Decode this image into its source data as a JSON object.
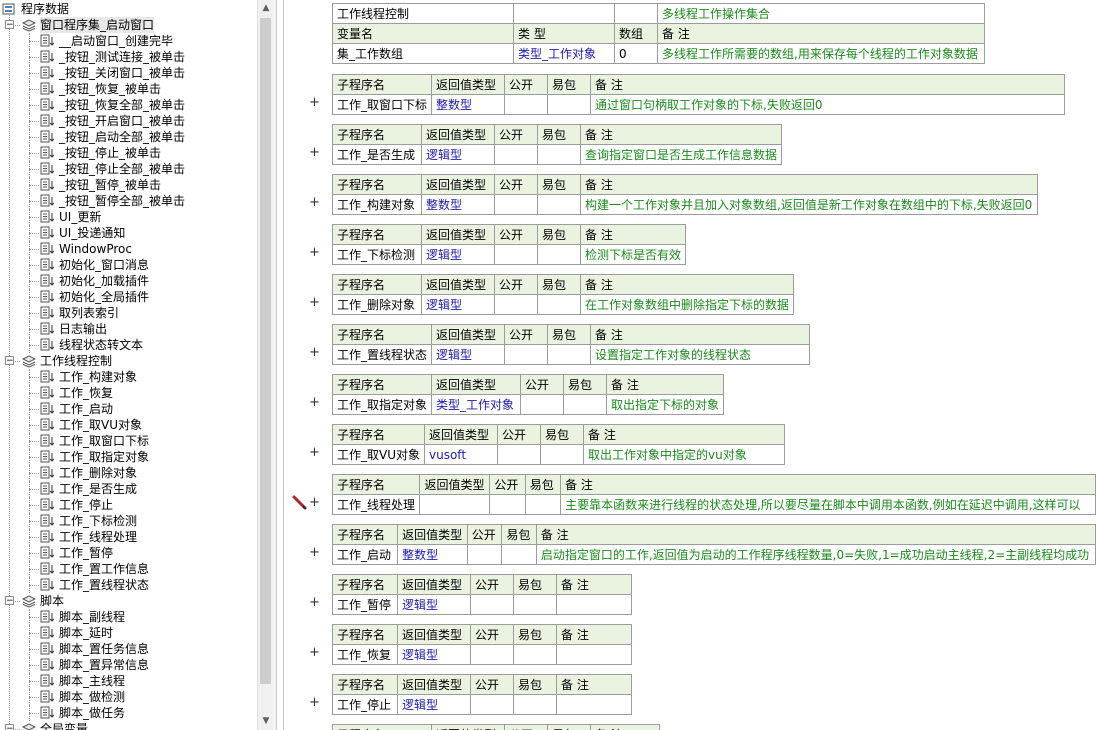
{
  "tree": {
    "root_label": "程序数据",
    "groups": [
      {
        "label": "窗口程序集_启动窗口",
        "items": [
          "__启动窗口_创建完毕",
          "_按钮_测试连接_被单击",
          "_按钮_关闭窗口_被单击",
          "_按钮_恢复_被单击",
          "_按钮_恢复全部_被单击",
          "_按钮_开启窗口_被单击",
          "_按钮_启动全部_被单击",
          "_按钮_停止_被单击",
          "_按钮_停止全部_被单击",
          "_按钮_暂停_被单击",
          "_按钮_暂停全部_被单击",
          "UI_更新",
          "UI_投递通知",
          "WindowProc",
          "初始化_窗口消息",
          "初始化_加载插件",
          "初始化_全局插件",
          "取列表索引",
          "日志输出",
          "线程状态转文本"
        ]
      },
      {
        "label": "工作线程控制",
        "items": [
          "工作_构建对象",
          "工作_恢复",
          "工作_启动",
          "工作_取VU对象",
          "工作_取窗口下标",
          "工作_取指定对象",
          "工作_删除对象",
          "工作_是否生成",
          "工作_停止",
          "工作_下标检测",
          "工作_线程处理",
          "工作_暂停",
          "工作_置工作信息",
          "工作_置线程状态"
        ]
      },
      {
        "label": "脚本",
        "items": [
          "脚本_副线程",
          "脚本_延时",
          "脚本_置任务信息",
          "脚本_置异常信息",
          "脚本_主线程",
          "脚本_做检测",
          "脚本_做任务"
        ]
      },
      {
        "label": "全局变量",
        "items": []
      }
    ]
  },
  "editor": {
    "header_block": {
      "top_row": {
        "name": "工作线程控制",
        "note": "多线程工作操作集合"
      },
      "var_header": [
        "变量名",
        "类 型",
        "数组",
        "备 注"
      ],
      "var_row": {
        "name": "集_工作数组",
        "type": "类型_工作对象",
        "array": "0",
        "note": "多线程工作所需要的数组,用来保存每个线程的工作对象数据"
      }
    },
    "sub_header": [
      "子程序名",
      "返回值类型",
      "公开",
      "易包",
      "备 注"
    ],
    "subs": [
      {
        "name": "工作_取窗口下标",
        "ret": "整数型",
        "note": "通过窗口句柄取工作对象的下标,失败返回0"
      },
      {
        "name": "工作_是否生成",
        "ret": "逻辑型",
        "note": "查询指定窗口是否生成工作信息数据"
      },
      {
        "name": "工作_构建对象",
        "ret": "整数型",
        "note": "构建一个工作对象并且加入对象数组,返回值是新工作对象在数组中的下标,失败返回0"
      },
      {
        "name": "工作_下标检测",
        "ret": "逻辑型",
        "note": "检测下标是否有效"
      },
      {
        "name": "工作_删除对象",
        "ret": "逻辑型",
        "note": "在工作对象数组中删除指定下标的数据"
      },
      {
        "name": "工作_置线程状态",
        "ret": "逻辑型",
        "note": "设置指定工作对象的线程状态"
      },
      {
        "name": "工作_取指定对象",
        "ret": "类型_工作对象",
        "note": "取出指定下标的对象"
      },
      {
        "name": "工作_取VU对象",
        "ret": "vusoft",
        "note": "取出工作对象中指定的vu对象"
      },
      {
        "name": "工作_线程处理",
        "ret": "",
        "note": "主要靠本函数来进行线程的状态处理,所以要尽量在脚本中调用本函数,例如在延迟中调用,这样可以"
      },
      {
        "name": "工作_启动",
        "ret": "整数型",
        "note": "启动指定窗口的工作,返回值为启动的工作程序线程数量,0=失败,1=成功启动主线程,2=主副线程均成功"
      },
      {
        "name": "工作_暂停",
        "ret": "逻辑型",
        "note": ""
      },
      {
        "name": "工作_恢复",
        "ret": "逻辑型",
        "note": ""
      },
      {
        "name": "工作_停止",
        "ret": "逻辑型",
        "note": ""
      },
      {
        "name": "",
        "ret": "",
        "note": ""
      }
    ],
    "plus_symbol": "+"
  }
}
